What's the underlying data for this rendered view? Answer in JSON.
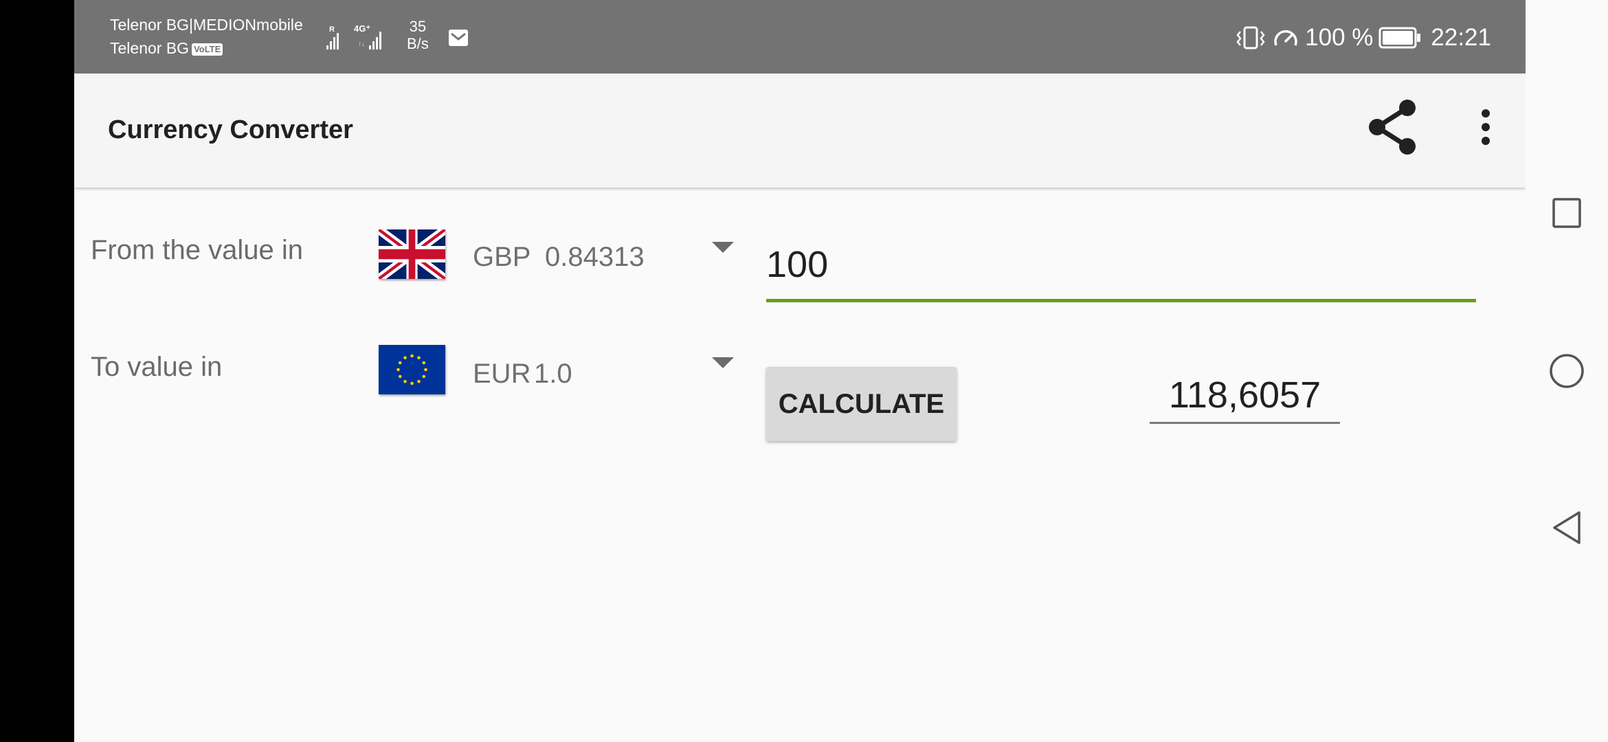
{
  "status_bar": {
    "carrier_1": "Telenor BG|MEDIONmobile",
    "carrier_2": "Telenor BG",
    "volte": "VoLTE",
    "roaming_mark": "R",
    "network_type": "4G⁺",
    "data_speed_value": "35",
    "data_speed_unit": "B/s",
    "battery_percent": "100 %",
    "time": "22:21",
    "icons": [
      "signal-icon",
      "mail-icon",
      "vibrate-icon",
      "data-saver-icon",
      "battery-icon"
    ]
  },
  "app_bar": {
    "title": "Currency Converter",
    "icons": [
      "share-icon",
      "overflow-menu-icon"
    ]
  },
  "converter": {
    "from_label": "From the value in",
    "from_currency": {
      "code": "GBP",
      "rate": "0.84313",
      "flag": "uk-flag-icon"
    },
    "amount": "100",
    "to_label": "To value in",
    "to_currency": {
      "code": "EUR",
      "rate": "1.0",
      "flag": "eu-flag-icon"
    },
    "calculate_label": "CALCULATE",
    "result": "118,6057"
  },
  "nav_bar": {
    "icons": [
      "recents-icon",
      "home-icon",
      "back-icon"
    ]
  },
  "colors": {
    "status_bar": "#737373",
    "app_bar": "#f5f5f5",
    "background": "#fafafa",
    "input_underline": "#6a9e1a",
    "button": "#d9d9d9"
  }
}
